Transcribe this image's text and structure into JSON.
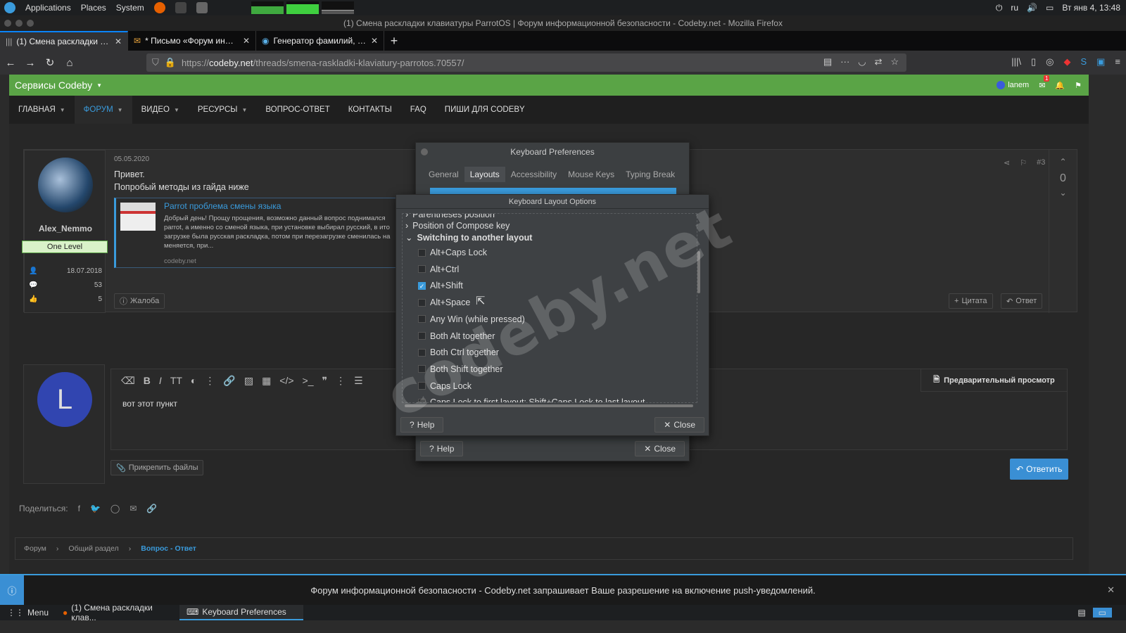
{
  "top_panel": {
    "menus": [
      "Applications",
      "Places",
      "System"
    ],
    "keyboard_layout": "ru",
    "clock": "Вт янв 4, 13:48"
  },
  "window": {
    "title": "(1) Смена раскладки клавиатуры ParrotOS | Форум информационной безопасности - Codeby.net - Mozilla Firefox"
  },
  "tabs": [
    {
      "label": "(1) Смена раскладки кла...",
      "active": true
    },
    {
      "label": "* Письмо «Форум инфор...",
      "active": false
    },
    {
      "label": "Генератор фамилий, им...",
      "active": false
    }
  ],
  "url": {
    "prefix": "https://",
    "host": "codeby.net",
    "path": "/threads/smena-raskladki-klaviatury-parrotos.70557/"
  },
  "site": {
    "services": "Сервисы Codeby",
    "username": "lanem",
    "notification_count": "1",
    "nav": [
      {
        "label": "ГЛАВНАЯ",
        "caret": true,
        "active": false
      },
      {
        "label": "ФОРУМ",
        "caret": true,
        "active": true
      },
      {
        "label": "ВИДЕО",
        "caret": true,
        "active": false
      },
      {
        "label": "РЕСУРСЫ",
        "caret": true,
        "active": false
      },
      {
        "label": "ВОПРОС-ОТВЕТ",
        "caret": false,
        "active": false
      },
      {
        "label": "КОНТАКТЫ",
        "caret": false,
        "active": false
      },
      {
        "label": "FAQ",
        "caret": false,
        "active": false
      },
      {
        "label": "ПИШИ ДЛЯ CODEBY",
        "caret": false,
        "active": false
      }
    ]
  },
  "post": {
    "date": "05.05.2020",
    "number": "#3",
    "greeting": "Привет.",
    "text": "Попробый методы из гайда ниже",
    "author": "Alex_Nemmo",
    "rank": "One Level",
    "joined": "18.07.2018",
    "messages": "53",
    "likes": "5",
    "votes": "0",
    "link_title": "Parrot проблема смены языка",
    "link_snippet": "Добрый день! Прощу прощения, возможно данный вопрос поднимался parrot, а именно со сменой языка, при установке выбирал русский, в ито загрузке была русская раскладка, потом при перезагрузке сменилась на меняется, при...",
    "link_domain": "codeby.net",
    "report": "Жалоба",
    "quote": "Цитата",
    "reply": "Ответ"
  },
  "editor": {
    "avatar_letter": "L",
    "text": "вот этот пункт",
    "preview": "Предварительный просмотр",
    "attach": "Прикрепить файлы",
    "submit": "Ответить"
  },
  "share_label": "Поделиться:",
  "breadcrumb": [
    "Форум",
    "Общий раздел",
    "Вопрос - Ответ"
  ],
  "keyboard_prefs": {
    "title": "Keyboard Preferences",
    "tabs": [
      "General",
      "Layouts",
      "Accessibility",
      "Mouse Keys",
      "Typing Break"
    ],
    "selected_tab": "Layouts",
    "help": "Help",
    "close": "Close"
  },
  "layout_options": {
    "title": "Keyboard Layout Options",
    "groups": [
      {
        "label": "Parentheses position",
        "expanded": false
      },
      {
        "label": "Position of Compose key",
        "expanded": false
      },
      {
        "label": "Switching to another layout",
        "expanded": true
      }
    ],
    "options": [
      {
        "label": "Alt+Caps Lock",
        "checked": false
      },
      {
        "label": "Alt+Ctrl",
        "checked": false
      },
      {
        "label": "Alt+Shift",
        "checked": true
      },
      {
        "label": "Alt+Space",
        "checked": false
      },
      {
        "label": "Any Win (while pressed)",
        "checked": false
      },
      {
        "label": "Both Alt together",
        "checked": false
      },
      {
        "label": "Both Ctrl together",
        "checked": false
      },
      {
        "label": "Both Shift together",
        "checked": false
      },
      {
        "label": "Caps Lock",
        "checked": false
      },
      {
        "label": "Caps Lock to first layout; Shift+Caps Lock to last layout",
        "checked": false
      }
    ],
    "help": "Help",
    "close": "Close"
  },
  "notification": "Форум информационной безопасности - Codeby.net запрашивает Ваше разрешение на включение push-уведомлений.",
  "taskbar": {
    "menu": "Menu",
    "tasks": [
      {
        "label": "(1) Смена раскладки клав...",
        "active": false
      },
      {
        "label": "Keyboard Preferences",
        "active": true
      }
    ]
  },
  "watermark": "codeby.net"
}
